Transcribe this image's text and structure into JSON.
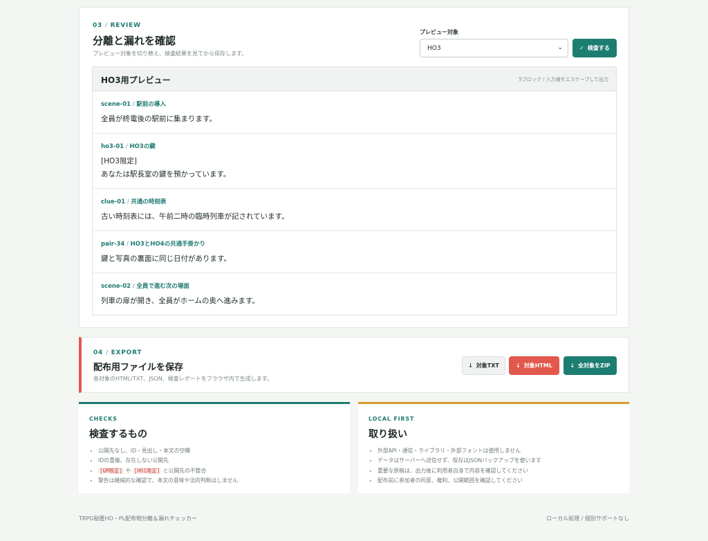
{
  "review": {
    "eyebrow_num": "03",
    "eyebrow_label": "REVIEW",
    "title": "分離と漏れを確認",
    "subtitle": "プレビュー対象を切り替え、検査結果を見てから保存します。",
    "select_label": "プレビュー対象",
    "select_value": "HO3",
    "check_button": "検査する",
    "preview_title": "HO3用プレビュー",
    "preview_note": "5ブロック / 入力値をエスケープして出力",
    "blocks": [
      {
        "id": "scene-01",
        "title": "駅前の導入",
        "lines": [
          "全員が終電後の駅前に集まります。"
        ]
      },
      {
        "id": "ho3-01",
        "title": "HO3の鍵",
        "lines": [
          "[HO3限定]",
          "あなたは駅長室の鍵を預かっています。"
        ]
      },
      {
        "id": "clue-01",
        "title": "共通の時刻表",
        "lines": [
          "古い時刻表には、午前二時の臨時列車が記されています。"
        ]
      },
      {
        "id": "pair-34",
        "title": "HO3とHO4の共通手掛かり",
        "lines": [
          "鍵と写真の裏面に同じ日付があります。"
        ]
      },
      {
        "id": "scene-02",
        "title": "全員で進む次の場面",
        "lines": [
          "列車の扉が開き、全員がホームの奥へ進みます。"
        ]
      }
    ]
  },
  "export": {
    "eyebrow_num": "04",
    "eyebrow_label": "EXPORT",
    "title": "配布用ファイルを保存",
    "subtitle": "各対象のHTML/TXT、JSON、検査レポートをブラウザ内で生成します。",
    "txt_button": "対象TXT",
    "html_button": "対象HTML",
    "zip_button": "全対象をZIP"
  },
  "checks": {
    "eyebrow": "CHECKS",
    "title": "検査するもの",
    "items": {
      "i1": "公開先なし、ID・見出し・本文の空欄",
      "i2": "IDの重複、存在しない公開先",
      "i3_tag1": "[GM限定]",
      "i3_mid": "や",
      "i3_tag2": "[HO1限定]",
      "i3_end": "と公開先の不整合",
      "i4": "警告は機械的な確認で、本文の意味や法的判断はしません"
    }
  },
  "local": {
    "eyebrow": "LOCAL FIRST",
    "title": "取り扱い",
    "items": [
      "外部API・通信・ライブラリ・外部フォントは使用しません",
      "データはサーバーへ送信せず、保存はJSONバックアップを使います",
      "重要な原稿は、出力後に利用者自身で内容を確認してください",
      "配布前に参加者の同意、権利、公開範囲を確認してください"
    ]
  },
  "footer": {
    "left": "TRPG秘匿HO・PL配布物分離＆漏れチェッカー",
    "right": "ローカル処理 / 個別サポートなし"
  },
  "colors": {
    "accent": "#1c7d71",
    "danger": "#e2584d",
    "warning": "#d99a2b"
  }
}
